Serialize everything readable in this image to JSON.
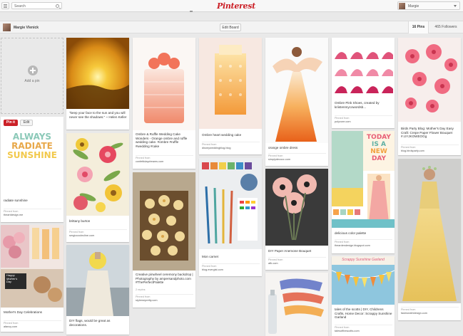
{
  "header": {
    "search_placeholder": "Search",
    "logo": "Pinterest",
    "user_name": "Margie"
  },
  "board": {
    "owner": "Margie Vlenick",
    "edit_label": "Edit Board",
    "pins_count": "16 Pins",
    "followers_count": "465 Followers"
  },
  "add_pin": {
    "label": "Add a pin"
  },
  "pin_actions": {
    "pin_it": "Pin it",
    "edit": "Edit"
  },
  "colors": {
    "brand": "#cb2027",
    "background": "#e9e9e9"
  },
  "pins": [
    {
      "desc": "\"keep your face to the sun and you will never see the shadows.\" ~ Helen Keller"
    },
    {
      "desc": "Ombre & Ruffle Wedding Cake Wonders - Orange ombre and ruffle wedding cake. #ombre #ruffle #wedding #cake",
      "src_label": "Pinned from",
      "src": "confettidaydreams.com"
    },
    {
      "desc": "Ombre heart wedding cake",
      "src_label": "Pinned from",
      "src": "disneyweddingblog.blog"
    },
    {
      "desc": "orange ombre dress",
      "src_label": "Pinned from",
      "src": "simplydecocc.com"
    },
    {
      "desc": "Ombre Pink Shoes, created by kriistenmycowordsb...",
      "src_label": "Pinned from",
      "src": "polyvore.com"
    },
    {
      "desc": "Birds Party Blog: Mother's Day Easy Craft: Crepe Paper Flower Bouquet #.UYJKOWEOGg",
      "src_label": "Pinned from",
      "src": "blog.birdsparty.com"
    },
    {
      "desc": "radiate sunshine",
      "src_label": "Pinned from",
      "src": "theartdesign.me",
      "art_words": [
        "ALWAYS",
        "RADIATE",
        "SUNSHINE"
      ]
    },
    {
      "desc": "brittany burton",
      "src_label": "Pinned from",
      "src": "sergiococlecline.com"
    },
    {
      "desc": "Creative pinwheel ceremony backdrop | Photography by ampersandphoto.com #ThePerfectPalette",
      "meta": "2 repins",
      "src_label": "Pinned from",
      "src": "stylemepretty.com"
    },
    {
      "desc": "Mon carnet",
      "src_label": "Pinned from",
      "src": "blog.evergist.com"
    },
    {
      "desc": "DIY Paper Anemone Bouquet",
      "src_label": "Pinned from",
      "src": "afb.com"
    },
    {
      "desc": "delicious color palette",
      "src_label": "Pinned from",
      "src": "theardendesign.blogspot.com",
      "art_words": [
        "TODAY",
        "IS A",
        "NEW",
        "DAY"
      ]
    },
    {
      "desc": "Mother's Day Celebrations",
      "src_label": "Pinned from",
      "src": "afancy.com",
      "art_words": [
        "Happy",
        "Mother's",
        "Day"
      ]
    },
    {
      "desc": "DIY flags, would be great as decorations.",
      "src_label": "Pinned from",
      "src": "lalalapaperie.com"
    },
    {
      "desc": "tales of the scotts | DIY, Childrens Crafts, Home Decor: Scrappy Sunshine Garland",
      "src_label": "Pinned from",
      "src": "talesofthescotts.com",
      "art_words": [
        "Scrappy Sunshine Garland"
      ]
    },
    {
      "desc": "",
      "src_label": "Pinned from",
      "src": "fashiondirtdesign.com"
    }
  ]
}
